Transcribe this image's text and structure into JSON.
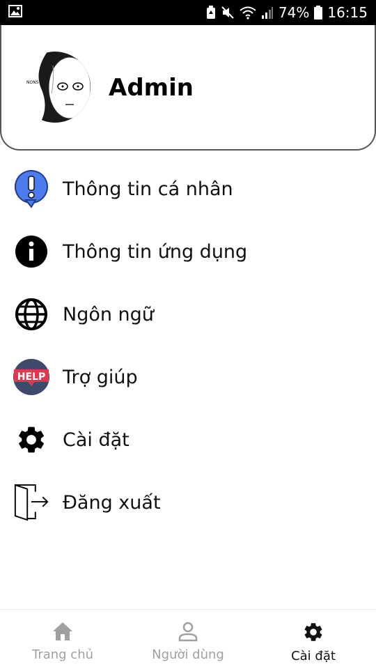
{
  "status_bar": {
    "battery_percent": "74%",
    "time": "16:15",
    "icons": [
      "image-icon",
      "battery-saver-icon",
      "mute-icon",
      "wifi-icon",
      "signal-icon",
      "battery-icon"
    ]
  },
  "profile": {
    "name": "Admin",
    "avatar_icon": "avatar-manga-face"
  },
  "menu": {
    "items": [
      {
        "label": "Thông tin cá nhân",
        "icon": "alert-bubble-icon"
      },
      {
        "label": "Thông tin ứng dụng",
        "icon": "info-icon"
      },
      {
        "label": "Ngôn ngữ",
        "icon": "globe-icon"
      },
      {
        "label": "Trợ giúp",
        "icon": "help-badge-icon",
        "badge_text": "HELP"
      },
      {
        "label": "Cài đặt",
        "icon": "gear-icon"
      },
      {
        "label": "Đăng xuất",
        "icon": "logout-door-icon"
      }
    ]
  },
  "bottom_nav": {
    "tabs": [
      {
        "label": "Trang chủ",
        "icon": "home-icon",
        "active": false
      },
      {
        "label": "Người dùng",
        "icon": "user-icon",
        "active": false
      },
      {
        "label": "Cài đặt",
        "icon": "gear-icon",
        "active": true
      }
    ]
  },
  "colors": {
    "status_bar_bg": "#000000",
    "help_badge": "#e8344e",
    "help_circle": "#3d4a6b",
    "alert_bubble": "#4b7bec",
    "inactive_nav": "#a0a0a0",
    "active_nav": "#111111"
  }
}
